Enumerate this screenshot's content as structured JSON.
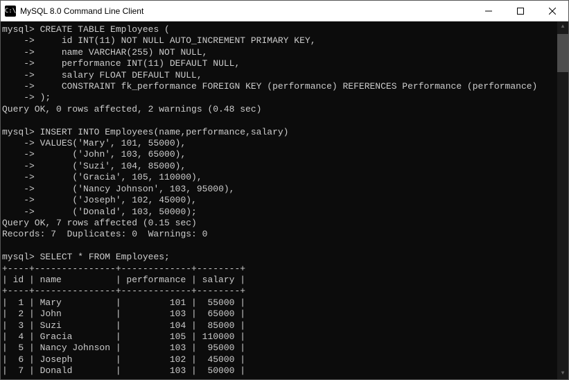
{
  "window": {
    "title": "MySQL 8.0 Command Line Client",
    "icon_char": "C:\\"
  },
  "terminal": {
    "prompt": "mysql>",
    "cont": "    ->",
    "create": {
      "cmd": "CREATE TABLE Employees (",
      "l1": "    id INT(11) NOT NULL AUTO_INCREMENT PRIMARY KEY,",
      "l2": "    name VARCHAR(255) NOT NULL,",
      "l3": "    performance INT(11) DEFAULT NULL,",
      "l4": "    salary FLOAT DEFAULT NULL,",
      "l5": "    CONSTRAINT fk_performance FOREIGN KEY (performance) REFERENCES Performance (performance)",
      "l6": ");",
      "result": "Query OK, 0 rows affected, 2 warnings (0.48 sec)"
    },
    "insert": {
      "cmd": "INSERT INTO Employees(name,performance,salary)",
      "l1": "VALUES('Mary', 101, 55000),",
      "l2": "      ('John', 103, 65000),",
      "l3": "      ('Suzi', 104, 85000),",
      "l4": "      ('Gracia', 105, 110000),",
      "l5": "      ('Nancy Johnson', 103, 95000),",
      "l6": "      ('Joseph', 102, 45000),",
      "l7": "      ('Donald', 103, 50000);",
      "result1": "Query OK, 7 rows affected (0.15 sec)",
      "result2": "Records: 7  Duplicates: 0  Warnings: 0"
    },
    "select": {
      "cmd": "SELECT * FROM Employees;"
    },
    "table": {
      "sep": "+----+---------------+-------------+--------+",
      "header": "| id | name          | performance | salary |",
      "rows": [
        "|  1 | Mary          |         101 |  55000 |",
        "|  2 | John          |         103 |  65000 |",
        "|  3 | Suzi          |         104 |  85000 |",
        "|  4 | Gracia        |         105 | 110000 |",
        "|  5 | Nancy Johnson |         103 |  95000 |",
        "|  6 | Joseph        |         102 |  45000 |",
        "|  7 | Donald        |         103 |  50000 |"
      ]
    }
  },
  "chart_data": {
    "type": "table",
    "title": "Employees",
    "columns": [
      "id",
      "name",
      "performance",
      "salary"
    ],
    "rows": [
      [
        1,
        "Mary",
        101,
        55000
      ],
      [
        2,
        "John",
        103,
        65000
      ],
      [
        3,
        "Suzi",
        104,
        85000
      ],
      [
        4,
        "Gracia",
        105,
        110000
      ],
      [
        5,
        "Nancy Johnson",
        103,
        95000
      ],
      [
        6,
        "Joseph",
        102,
        45000
      ],
      [
        7,
        "Donald",
        103,
        50000
      ]
    ]
  }
}
